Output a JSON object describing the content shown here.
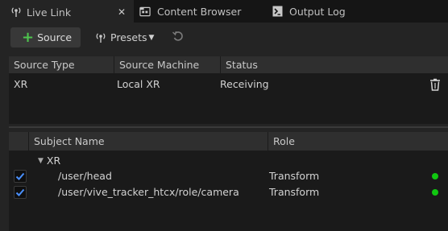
{
  "tabs": [
    {
      "label": "Live Link",
      "icon": "live-link-icon",
      "active": true
    },
    {
      "label": "Content Browser",
      "icon": "folder-icon"
    },
    {
      "label": "Output Log",
      "icon": "terminal-icon"
    }
  ],
  "toolbar": {
    "source_label": "Source",
    "presets_label": "Presets"
  },
  "sources": {
    "columns": [
      "Source Type",
      "Source Machine",
      "Status"
    ],
    "rows": [
      {
        "type": "XR",
        "machine": "Local XR",
        "status": "Receiving"
      }
    ]
  },
  "subjects": {
    "columns": [
      "Subject Name",
      "Role"
    ],
    "group": "XR",
    "rows": [
      {
        "name": "/user/head",
        "role": "Transform",
        "checked": true,
        "status_color": "#10c810"
      },
      {
        "name": "/user/vive_tracker_htcx/role/camera",
        "role": "Transform",
        "checked": true,
        "status_color": "#10c810"
      }
    ]
  },
  "colors": {
    "accent_blue": "#4a90ff",
    "status_green": "#10c810",
    "add_green": "#4ec54e"
  }
}
